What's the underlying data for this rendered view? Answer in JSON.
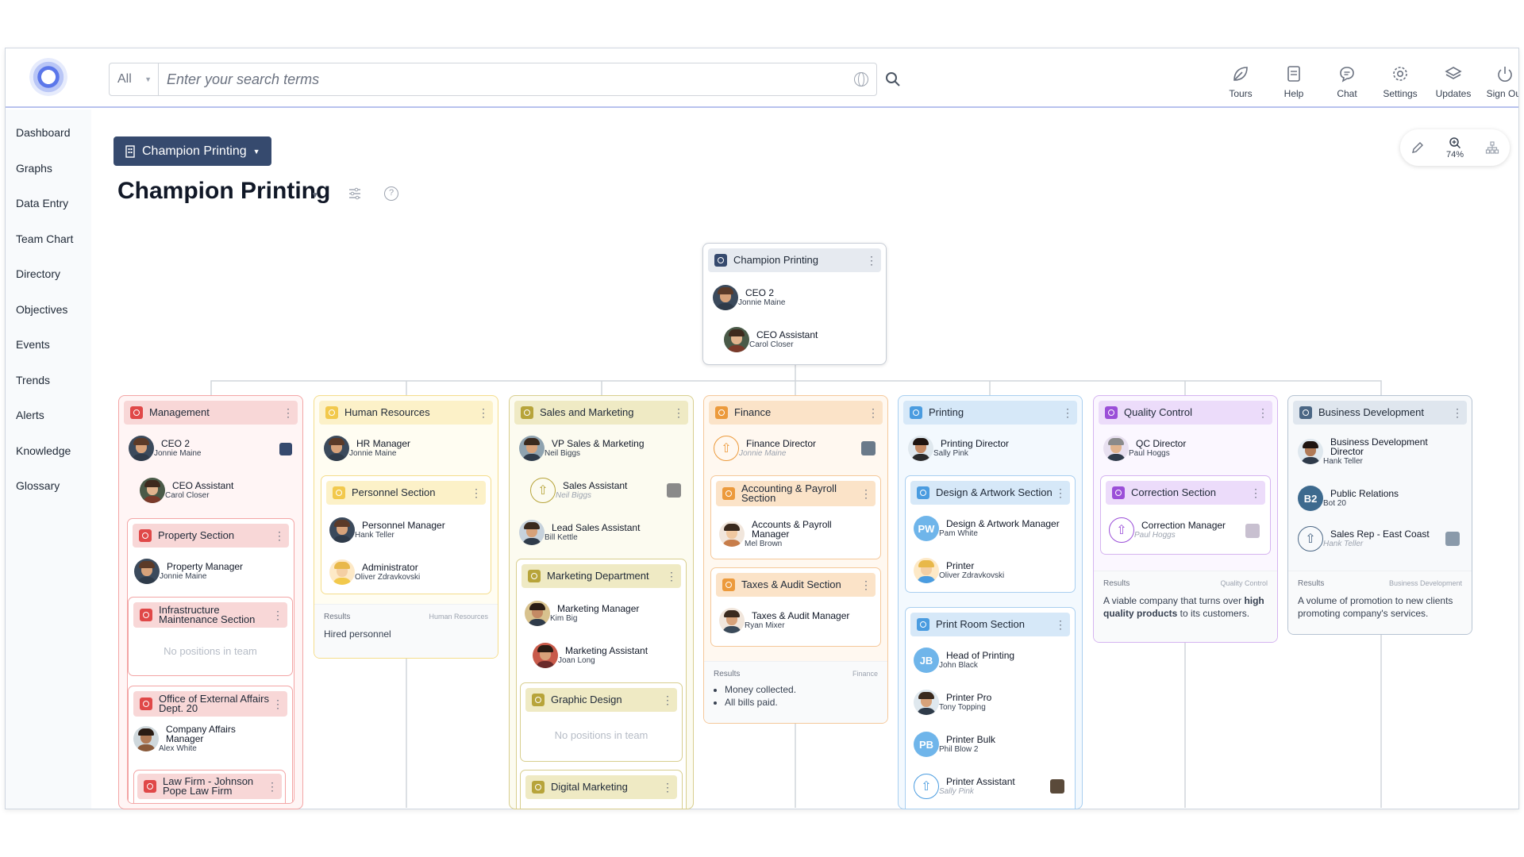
{
  "search": {
    "scope": "All",
    "placeholder": "Enter your search terms"
  },
  "toolbar": [
    {
      "label": "Tours",
      "icon": "leaf-icon"
    },
    {
      "label": "Help",
      "icon": "document-icon"
    },
    {
      "label": "Chat",
      "icon": "chat-bubble-icon"
    },
    {
      "label": "Settings",
      "icon": "gear-icon"
    },
    {
      "label": "Updates",
      "icon": "layers-icon"
    },
    {
      "label": "Sign Out",
      "icon": "power-icon"
    }
  ],
  "sidebar": [
    "Dashboard",
    "Graphs",
    "Data Entry",
    "Team Chart",
    "Directory",
    "Objectives",
    "Events",
    "Trends",
    "Alerts",
    "Knowledge",
    "Glossary"
  ],
  "org_button": "Champion Printing",
  "page_title": "Champion Printing",
  "zoom": "74%",
  "colors": {
    "accent": "#364a6e",
    "management": "#e04848",
    "hr": "#f2c94c",
    "sales": "#b7a43a",
    "finance": "#ec9a3c",
    "printing": "#4a9ce0",
    "quality": "#9b4fd8",
    "business": "#4b6785"
  },
  "root": {
    "title": "Champion Printing",
    "positions": [
      {
        "title": "CEO 2",
        "name": "Jonnie Maine"
      },
      {
        "title": "CEO Assistant",
        "name": "Carol Closer"
      }
    ]
  },
  "management": {
    "title": "Management",
    "positions": [
      {
        "title": "CEO 2",
        "name": "Jonnie Maine"
      },
      {
        "title": "CEO Assistant",
        "name": "Carol Closer"
      }
    ],
    "property": {
      "title": "Property Section",
      "pos_title": "Property Manager",
      "pos_name": "Jonnie Maine"
    },
    "infra": {
      "title": "Infrastructure Maintenance Section",
      "empty": "No positions in team"
    },
    "external": {
      "title": "Office of External Affairs Dept. 20",
      "pos_title": "Company Affairs Manager",
      "pos_name": "Alex White"
    },
    "lawfirm": {
      "title": "Law Firm - Johnson Pope Law Firm"
    }
  },
  "hr": {
    "title": "Human Resources",
    "pos_title": "HR Manager",
    "pos_name": "Jonnie Maine",
    "section": {
      "title": "Personnel Section",
      "positions": [
        {
          "title": "Personnel Manager",
          "name": "Hank Teller"
        },
        {
          "title": "Administrator",
          "name": "Oliver Zdravkovski"
        }
      ]
    },
    "results_label": "Results",
    "results_tag": "Human Resources",
    "results": "Hired personnel"
  },
  "sales": {
    "title": "Sales and Marketing",
    "positions": [
      {
        "title": "VP Sales & Marketing",
        "name": "Neil Biggs"
      },
      {
        "title": "Sales Assistant",
        "name": "Neil Biggs"
      },
      {
        "title": "Lead Sales Assistant",
        "name": "Bill Kettle"
      }
    ],
    "marketing": {
      "title": "Marketing Department",
      "positions": [
        {
          "title": "Marketing Manager",
          "name": "Kim Big"
        },
        {
          "title": "Marketing Assistant",
          "name": "Joan Long"
        }
      ]
    },
    "graphic": {
      "title": "Graphic Design",
      "empty": "No positions in team"
    },
    "digital": {
      "title": "Digital Marketing"
    }
  },
  "finance": {
    "title": "Finance",
    "pos_title": "Finance Director",
    "pos_name": "Jonnie Maine",
    "accounts": {
      "title": "Accounting & Payroll Section",
      "pos_title": "Accounts & Payroll Manager",
      "pos_name": "Mel Brown"
    },
    "taxes": {
      "title": "Taxes & Audit Section",
      "pos_title": "Taxes & Audit Manager",
      "pos_name": "Ryan Mixer"
    },
    "results_label": "Results",
    "results_tag": "Finance",
    "results": [
      "Money collected.",
      "All bills paid."
    ]
  },
  "printing": {
    "title": "Printing",
    "pos_title": "Printing Director",
    "pos_name": "Sally Pink",
    "design": {
      "title": "Design & Artwork Section",
      "positions": [
        {
          "title": "Design & Artwork Manager",
          "name": "Pam White",
          "initials": "PW"
        },
        {
          "title": "Printer",
          "name": "Oliver Zdravkovski"
        }
      ]
    },
    "printroom": {
      "title": "Print Room Section",
      "positions": [
        {
          "title": "Head of Printing",
          "name": "John Black",
          "initials": "JB"
        },
        {
          "title": "Printer Pro",
          "name": "Tony Topping"
        },
        {
          "title": "Printer Bulk",
          "name": "Phil Blow 2",
          "initials": "PB"
        },
        {
          "title": "Printer Assistant",
          "name": "Sally Pink"
        }
      ]
    }
  },
  "quality": {
    "title": "Quality Control",
    "pos_title": "QC Director",
    "pos_name": "Paul Hoggs",
    "correction": {
      "title": "Correction Section",
      "pos_title": "Correction Manager",
      "pos_name": "Paul Hoggs"
    },
    "results_label": "Results",
    "results_tag": "Quality Control",
    "results_pre": "A viable company that turns over ",
    "results_bold": "high quality products",
    "results_post": " to its customers."
  },
  "business": {
    "title": "Business Development",
    "positions": [
      {
        "title": "Business Development Director",
        "name": "Hank Teller"
      },
      {
        "title": "Public Relations",
        "name": "Bot 20",
        "initials": "B2"
      },
      {
        "title": "Sales Rep - East Coast",
        "name": "Hank Teller"
      }
    ],
    "results_label": "Results",
    "results_tag": "Business Development",
    "results": "A volume of promotion to new clients promoting company's services."
  }
}
